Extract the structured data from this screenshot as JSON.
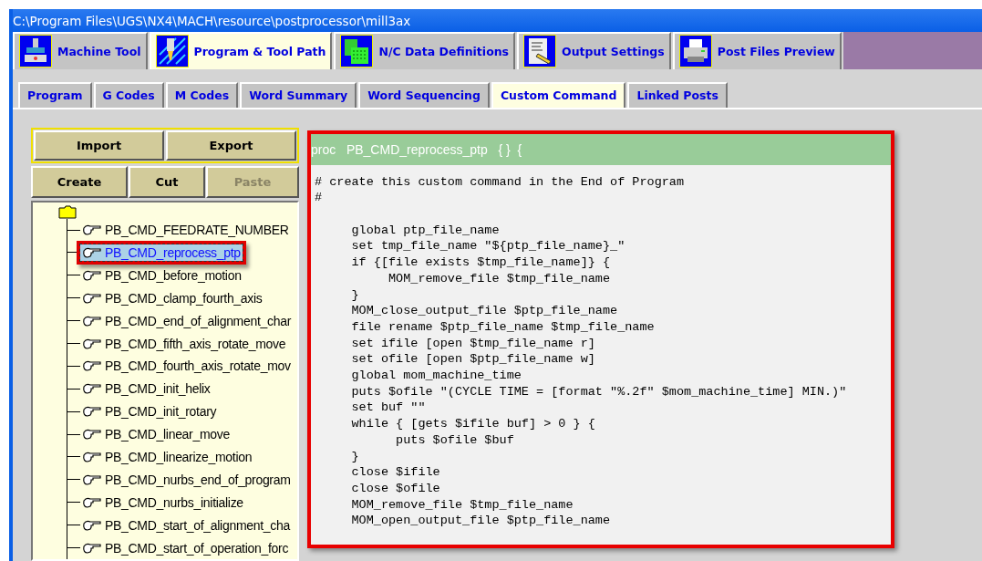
{
  "window": {
    "title": "C:\\Program Files\\UGS\\NX4\\MACH\\resource\\postprocessor\\mill3ax"
  },
  "main_tabs": [
    {
      "label": "Machine Tool",
      "selected": false
    },
    {
      "label": "Program & Tool Path",
      "selected": true
    },
    {
      "label": "N/C Data Definitions",
      "selected": false
    },
    {
      "label": "Output Settings",
      "selected": false
    },
    {
      "label": "Post Files Preview",
      "selected": false
    }
  ],
  "sub_tabs": [
    {
      "label": "Program",
      "selected": false
    },
    {
      "label": "G Codes",
      "selected": false
    },
    {
      "label": "M Codes",
      "selected": false
    },
    {
      "label": "Word Summary",
      "selected": false
    },
    {
      "label": "Word Sequencing",
      "selected": false
    },
    {
      "label": "Custom Command",
      "selected": true
    },
    {
      "label": "Linked Posts",
      "selected": false
    }
  ],
  "file_buttons": [
    {
      "label": "Import",
      "disabled": false
    },
    {
      "label": "Export",
      "disabled": false
    }
  ],
  "edit_buttons": [
    {
      "label": "Create",
      "disabled": false
    },
    {
      "label": "Cut",
      "disabled": false
    },
    {
      "label": "Paste",
      "disabled": true
    }
  ],
  "command_tree": {
    "expanded": true,
    "children": [
      {
        "label": "PB_CMD_FEEDRATE_NUMBER",
        "selected": false
      },
      {
        "label": "PB_CMD_reprocess_ptp",
        "selected": true
      },
      {
        "label": "PB_CMD_before_motion",
        "selected": false
      },
      {
        "label": "PB_CMD_clamp_fourth_axis",
        "selected": false
      },
      {
        "label": "PB_CMD_end_of_alignment_char",
        "selected": false
      },
      {
        "label": "PB_CMD_fifth_axis_rotate_move",
        "selected": false
      },
      {
        "label": "PB_CMD_fourth_axis_rotate_mov",
        "selected": false
      },
      {
        "label": "PB_CMD_init_helix",
        "selected": false
      },
      {
        "label": "PB_CMD_init_rotary",
        "selected": false
      },
      {
        "label": "PB_CMD_linear_move",
        "selected": false
      },
      {
        "label": "PB_CMD_linearize_motion",
        "selected": false
      },
      {
        "label": "PB_CMD_nurbs_end_of_program",
        "selected": false
      },
      {
        "label": "PB_CMD_nurbs_initialize",
        "selected": false
      },
      {
        "label": "PB_CMD_start_of_alignment_cha",
        "selected": false
      },
      {
        "label": "PB_CMD_start_of_operation_forc",
        "selected": false
      }
    ]
  },
  "editor": {
    "header": "proc   PB_CMD_reprocess_ptp   { }  {",
    "comment_lines": [
      "# create this custom command in the End of Program",
      "#"
    ],
    "lines": [
      "     global ptp_file_name",
      "     set tmp_file_name \"${ptp_file_name}_\"",
      "     if {[file exists $tmp_file_name]} {",
      "          MOM_remove_file $tmp_file_name",
      "     }",
      "     MOM_close_output_file $ptp_file_name",
      "     file rename $ptp_file_name $tmp_file_name",
      "     set ifile [open $tmp_file_name r]",
      "     set ofile [open $ptp_file_name w]",
      "     global mom_machine_time",
      "     puts $ofile \"(CYCLE TIME = [format \"%.2f\" $mom_machine_time] MIN.)\"",
      "     set buf \"\"",
      "     while { [gets $ifile buf] > 0 } {",
      "           puts $ofile $buf",
      "     }",
      "     close $ifile",
      "     close $ofile",
      "     MOM_remove_file $tmp_file_name",
      "     MOM_open_output_file $ptp_file_name"
    ]
  }
}
